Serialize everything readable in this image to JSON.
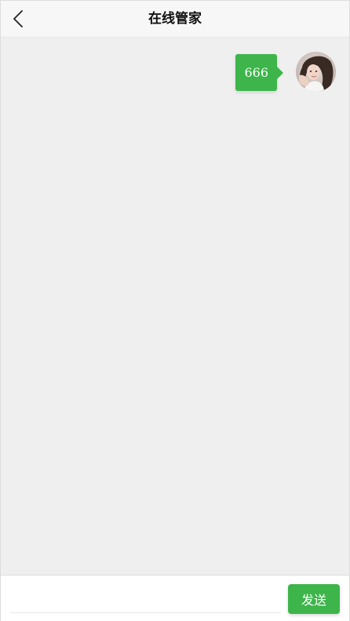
{
  "header": {
    "title": "在线管家",
    "back_icon": "chevron-left-icon"
  },
  "chat": {
    "messages": [
      {
        "text": "666",
        "sender": "self"
      }
    ]
  },
  "input_bar": {
    "input_value": "",
    "input_placeholder": "",
    "send_label": "发送"
  },
  "colors": {
    "accent": "#3db54a",
    "background": "#efefef",
    "header_bg": "#f7f7f7"
  }
}
